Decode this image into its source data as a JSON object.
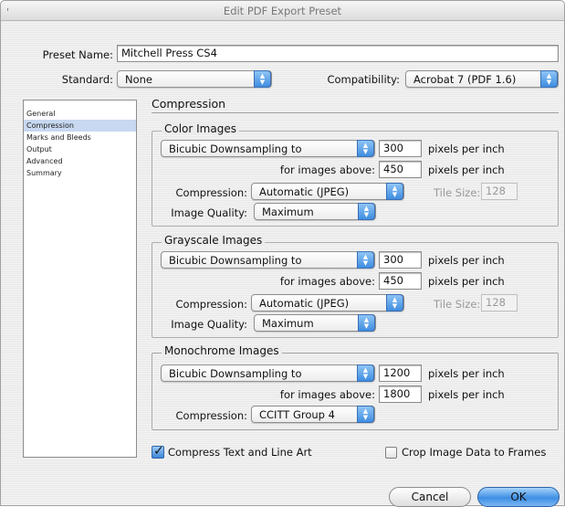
{
  "window": {
    "title": "Edit PDF Export Preset"
  },
  "preset": {
    "label": "Preset Name:",
    "value": "Mitchell Press CS4"
  },
  "standard": {
    "label": "Standard:",
    "value": "None"
  },
  "compatibility": {
    "label": "Compatibility:",
    "value": "Acrobat 7 (PDF 1.6)"
  },
  "sidebar": {
    "items": [
      {
        "label": "General",
        "selected": false
      },
      {
        "label": "Compression",
        "selected": true
      },
      {
        "label": "Marks and Bleeds",
        "selected": false
      },
      {
        "label": "Output",
        "selected": false
      },
      {
        "label": "Advanced",
        "selected": false
      },
      {
        "label": "Summary",
        "selected": false
      }
    ]
  },
  "panel": {
    "title": "Compression"
  },
  "color": {
    "title": "Color Images",
    "downsampling": "Bicubic Downsampling to",
    "ppi": "300",
    "ppi_unit": "pixels per inch",
    "above_label": "for images above:",
    "above_value": "450",
    "above_unit": "pixels per inch",
    "compression_label": "Compression:",
    "compression_value": "Automatic (JPEG)",
    "tile_label": "Tile Size:",
    "tile_value": "128",
    "quality_label": "Image Quality:",
    "quality_value": "Maximum"
  },
  "grayscale": {
    "title": "Grayscale Images",
    "downsampling": "Bicubic Downsampling to",
    "ppi": "300",
    "ppi_unit": "pixels per inch",
    "above_label": "for images above:",
    "above_value": "450",
    "above_unit": "pixels per inch",
    "compression_label": "Compression:",
    "compression_value": "Automatic (JPEG)",
    "tile_label": "Tile Size:",
    "tile_value": "128",
    "quality_label": "Image Quality:",
    "quality_value": "Maximum"
  },
  "mono": {
    "title": "Monochrome Images",
    "downsampling": "Bicubic Downsampling to",
    "ppi": "1200",
    "ppi_unit": "pixels per inch",
    "above_label": "for images above:",
    "above_value": "1800",
    "above_unit": "pixels per inch",
    "compression_label": "Compression:",
    "compression_value": "CCITT Group 4"
  },
  "options": {
    "compress_text": {
      "label": "Compress Text and Line Art",
      "checked": true
    },
    "crop_image": {
      "label": "Crop Image Data to Frames",
      "checked": false
    }
  },
  "buttons": {
    "cancel": "Cancel",
    "ok": "OK"
  },
  "colors": {
    "accent": "#3f8fe4",
    "selection": "#c7d8f0"
  }
}
